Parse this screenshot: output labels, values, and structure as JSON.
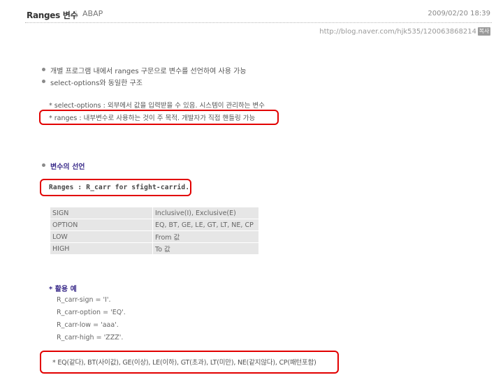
{
  "header": {
    "title": "Ranges 변수",
    "separator": "|",
    "category": "ABAP",
    "date": "2009/02/20 18:39"
  },
  "post_url": "http://blog.naver.com/hjk535/120063868214",
  "copy_badge": "복사",
  "intro_bullets": [
    "개별 프로그램 내에서 ranges 구문으로 변수를 선언하여 사용 가능",
    "select-options와 동일한 구조"
  ],
  "notes": {
    "select_options": "* select-options :  외부에서 값을 입력받을 수 있음. 시스템이 관리하는 변수",
    "ranges": "* ranges : 내부변수로 사용하는 것이 주 목적. 개발자가 직접 핸들링 가능"
  },
  "section_heading": "변수의 선언",
  "declaration": "Ranges : R_carr for sfight-carrid.",
  "table": [
    {
      "field": "SIGN",
      "value": "Inclusive(I), Exclusive(E)"
    },
    {
      "field": "OPTION",
      "value": "EQ, BT, GE, LE, GT, LT, NE, CP"
    },
    {
      "field": "LOW",
      "value": "From 값"
    },
    {
      "field": "HIGH",
      "value": "To 값"
    }
  ],
  "example": {
    "heading": "* 활용 예",
    "lines": [
      "R_carr-sign = 'I'.",
      "R_carr-option = 'EQ'.",
      "R_carr-low = 'aaa'.",
      "R_carr-high = 'ZZZ'."
    ]
  },
  "operators_note": "*  EQ(같다), BT(사이값), GE(이상), LE(이하), GT(초과), LT(미만), NE(같지않다), CP(패턴포함)",
  "colors": {
    "highlight_border": "#e20000",
    "heading": "#3a2b8a",
    "table_cell": "#e6e6e6"
  }
}
